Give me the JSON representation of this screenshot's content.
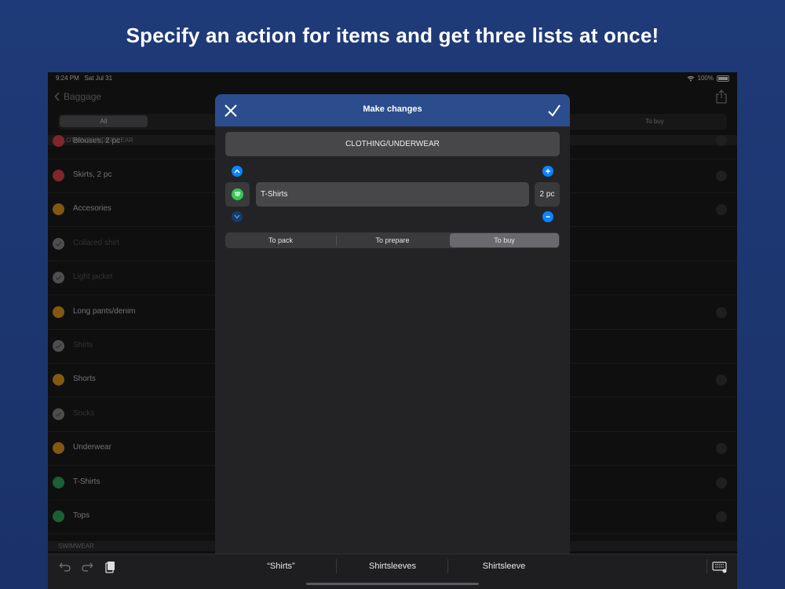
{
  "headline": "Specify an action for items and get three lists at once!",
  "status": {
    "time": "9:24 PM",
    "date": "Sat Jul 31",
    "battery": "100%"
  },
  "nav": {
    "back_label": "Baggage"
  },
  "filter": {
    "all_label": "All",
    "buy_label": "To buy"
  },
  "section": {
    "clothing": "CLOTHING/UNDERWEAR",
    "swimwear": "SWIMWEAR"
  },
  "list_items": [
    {
      "label": "Blouses, 2 pc",
      "dot_color": "#e5484d",
      "muted": false
    },
    {
      "label": "Skirts, 2 pc",
      "dot_color": "#e5484d",
      "muted": false
    },
    {
      "label": "Accesories",
      "dot_color": "#f0a020",
      "muted": false
    },
    {
      "label": "Collared shirt",
      "dot_color": "#8e8e93",
      "muted": true
    },
    {
      "label": "Light jacket",
      "dot_color": "#8e8e93",
      "muted": true
    },
    {
      "label": "Long pants/denim",
      "dot_color": "#f0a020",
      "muted": false
    },
    {
      "label": "Shirts",
      "dot_color": "#8e8e93",
      "muted": true
    },
    {
      "label": "Shorts",
      "dot_color": "#f0a020",
      "muted": false
    },
    {
      "label": "Socks",
      "dot_color": "#8e8e93",
      "muted": true
    },
    {
      "label": "Underwear",
      "dot_color": "#f0a020",
      "muted": false
    },
    {
      "label": "T-Shirts",
      "dot_color": "#30b060",
      "muted": false
    },
    {
      "label": "Tops",
      "dot_color": "#30b060",
      "muted": false
    }
  ],
  "modal": {
    "title": "Make changes",
    "category": "CLOTHING/UNDERWEAR",
    "item_name": "T-Shirts",
    "quantity": "2 pc",
    "actions": [
      "To pack",
      "To prepare",
      "To buy"
    ],
    "selected_action": "To buy"
  },
  "suggestions": [
    "“Shirts”",
    "Shirtsleeves",
    "Shirtsleeve"
  ],
  "colors": {
    "accent": "#0a84ff",
    "header": "#2c4d8d",
    "background": "#1f3a78"
  }
}
